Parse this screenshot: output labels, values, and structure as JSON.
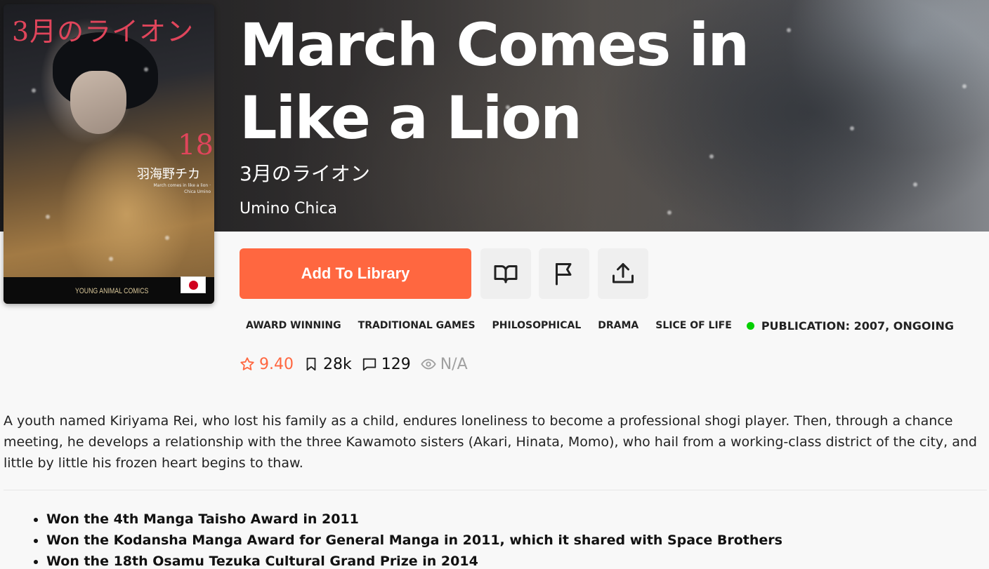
{
  "manga": {
    "title": "March Comes in Like a Lion",
    "alt_title": "3月のライオン",
    "author": "Umino Chica"
  },
  "cover": {
    "jp_title": "3月のライオン",
    "volume": "18",
    "author_jp": "羽海野チカ",
    "subtitle_en": "March comes in like a lion · Chica Umino",
    "publisher": "YOUNG ANIMAL COMICS",
    "flag": "japan-flag"
  },
  "actions": {
    "add_to_library": "Add To Library",
    "icons": [
      "book-open-icon",
      "flag-icon",
      "share-icon"
    ]
  },
  "tags": [
    "AWARD WINNING",
    "TRADITIONAL GAMES",
    "PHILOSOPHICAL",
    "DRAMA",
    "SLICE OF LIFE"
  ],
  "publication": {
    "label": "PUBLICATION: 2007, ONGOING",
    "status_color": "#04d000"
  },
  "stats": {
    "rating": "9.40",
    "follows": "28k",
    "comments": "129",
    "views": "N/A"
  },
  "description": "A youth named Kiriyama Rei, who lost his family as a child, endures loneliness to become a professional shogi player. Then, through a chance meeting, he develops a relationship with the three Kawamoto sisters (Akari, Hinata, Momo), who hail from a working-class district of the city, and little by little his frozen heart begins to thaw.",
  "awards": [
    "Won the 4th Manga Taisho Award in 2011",
    "Won the Kodansha Manga Award for General Manga in 2011, which it shared with Space Brothers",
    "Won the 18th Osamu Tezuka Cultural Grand Prize in 2014"
  ],
  "colors": {
    "accent": "#ff6740",
    "icon_button_bg": "#efefef",
    "page_bg": "#f8f8f8"
  }
}
